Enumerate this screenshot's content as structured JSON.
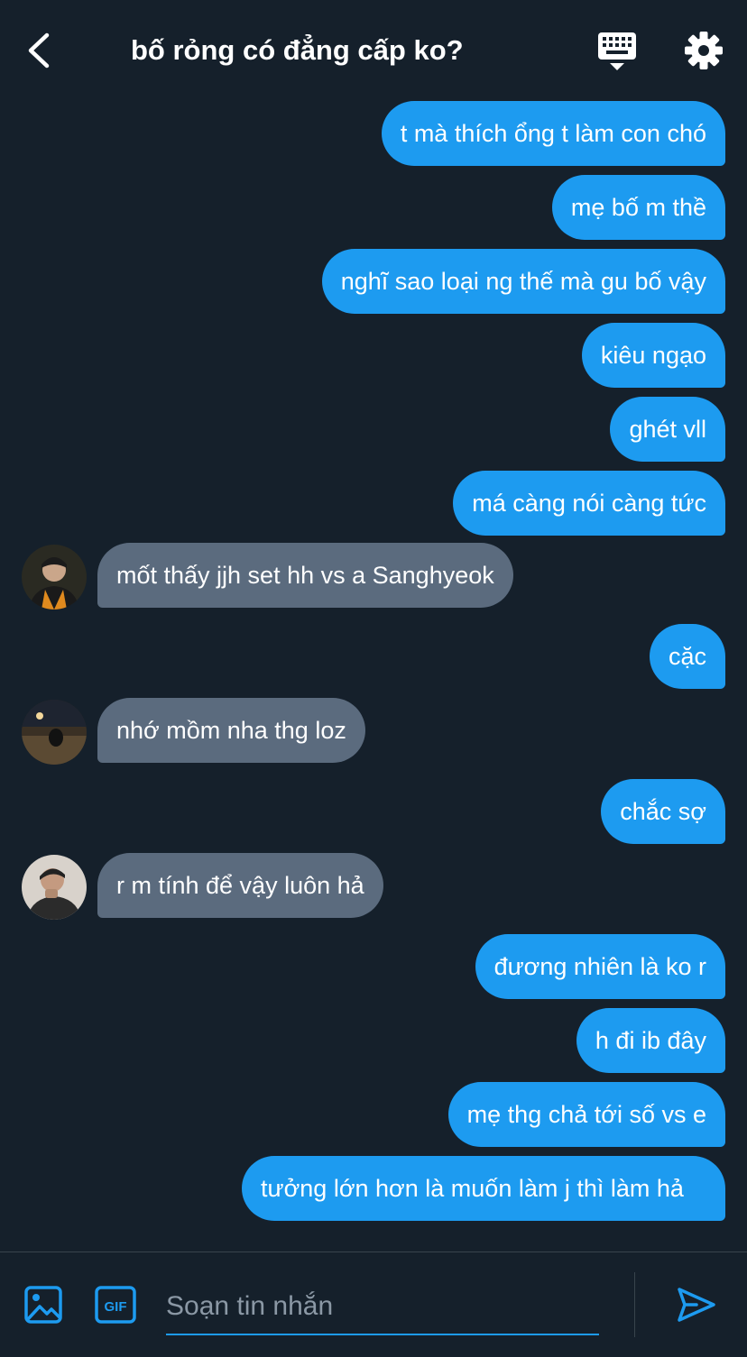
{
  "header": {
    "back_icon": "chevron-left-icon",
    "title": "bố rỏng có đẳng cấp ko?",
    "keyboard_icon": "keyboard-icon",
    "settings_icon": "gear-icon"
  },
  "colors": {
    "background": "#15202b",
    "outgoing_bubble": "#1d9bf0",
    "incoming_bubble": "#5b6b7e",
    "accent": "#1d9bf0",
    "placeholder": "#8b98a5"
  },
  "messages": [
    {
      "dir": "out",
      "text": "t mà thích ổng t làm con chó"
    },
    {
      "dir": "out",
      "text": "mẹ bố m thề"
    },
    {
      "dir": "out",
      "text": "nghĩ sao loại ng thế mà gu bố vậy"
    },
    {
      "dir": "out",
      "text": "kiêu ngạo"
    },
    {
      "dir": "out",
      "text": "ghét vll"
    },
    {
      "dir": "out",
      "text": "má càng nói càng tức"
    },
    {
      "dir": "in",
      "text": "mốt thấy jjh set hh vs a Sanghyeok"
    },
    {
      "dir": "out",
      "text": "cặc"
    },
    {
      "dir": "in",
      "text": "nhớ mồm nha thg loz"
    },
    {
      "dir": "out",
      "text": "chắc sợ"
    },
    {
      "dir": "in",
      "text": "r m tính để vậy luôn hả"
    },
    {
      "dir": "out",
      "text": "đương nhiên là ko r"
    },
    {
      "dir": "out",
      "text": "h đi ib đây"
    },
    {
      "dir": "out",
      "text": "mẹ thg chả tới số vs e"
    },
    {
      "dir": "out",
      "text": "tưởng lớn hơn là muốn làm j thì làm hả"
    }
  ],
  "composer": {
    "image_icon": "image-icon",
    "gif_icon": "gif-icon",
    "gif_label": "GIF",
    "placeholder": "Soạn tin nhắn",
    "value": "",
    "send_icon": "send-icon"
  }
}
